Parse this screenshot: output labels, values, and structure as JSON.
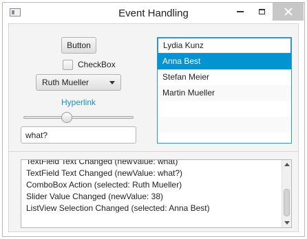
{
  "window": {
    "title": "Event Handling"
  },
  "controls": {
    "button_label": "Button",
    "checkbox_label": "CheckBox",
    "checkbox_checked": false,
    "combobox_selected": "Ruth Mueller",
    "hyperlink_label": "Hyperlink",
    "slider_value": 38,
    "textfield_value": "what?"
  },
  "listview": {
    "items": [
      {
        "label": "Lydia Kunz",
        "state": "editing"
      },
      {
        "label": "Anna Best",
        "state": "selected"
      },
      {
        "label": "Stefan Meier",
        "state": "normal"
      },
      {
        "label": "Martin Mueller",
        "state": "normal"
      }
    ]
  },
  "log": {
    "lines": [
      "TextField Text Changed (newValue: what)",
      "TextField Text Changed (newValue: what?)",
      "ComboBox Action (selected: Ruth Mueller)",
      "Slider Value Changed (newValue: 38)",
      "ListView Selection Changed (selected: Anna Best)"
    ]
  }
}
